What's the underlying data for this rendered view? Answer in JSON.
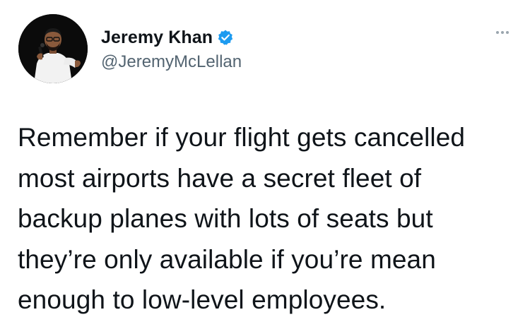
{
  "author": {
    "display_name": "Jeremy Khan",
    "handle": "@JeremyMcLellan",
    "verified": true,
    "verified_color": "#1d9bf0",
    "avatar_icon": "profile-photo-comedian-with-microphone"
  },
  "menu": {
    "icon": "more-horizontal-icon"
  },
  "tweet": {
    "lines": [
      "Remember if your flight gets cancelled",
      "most airports have a secret fleet of",
      "backup planes with lots of seats but",
      "they’re only available if you’re mean",
      "enough to low-level employees."
    ]
  },
  "colors": {
    "text": "#0f1419",
    "secondary_text": "#536471",
    "background": "#ffffff"
  }
}
